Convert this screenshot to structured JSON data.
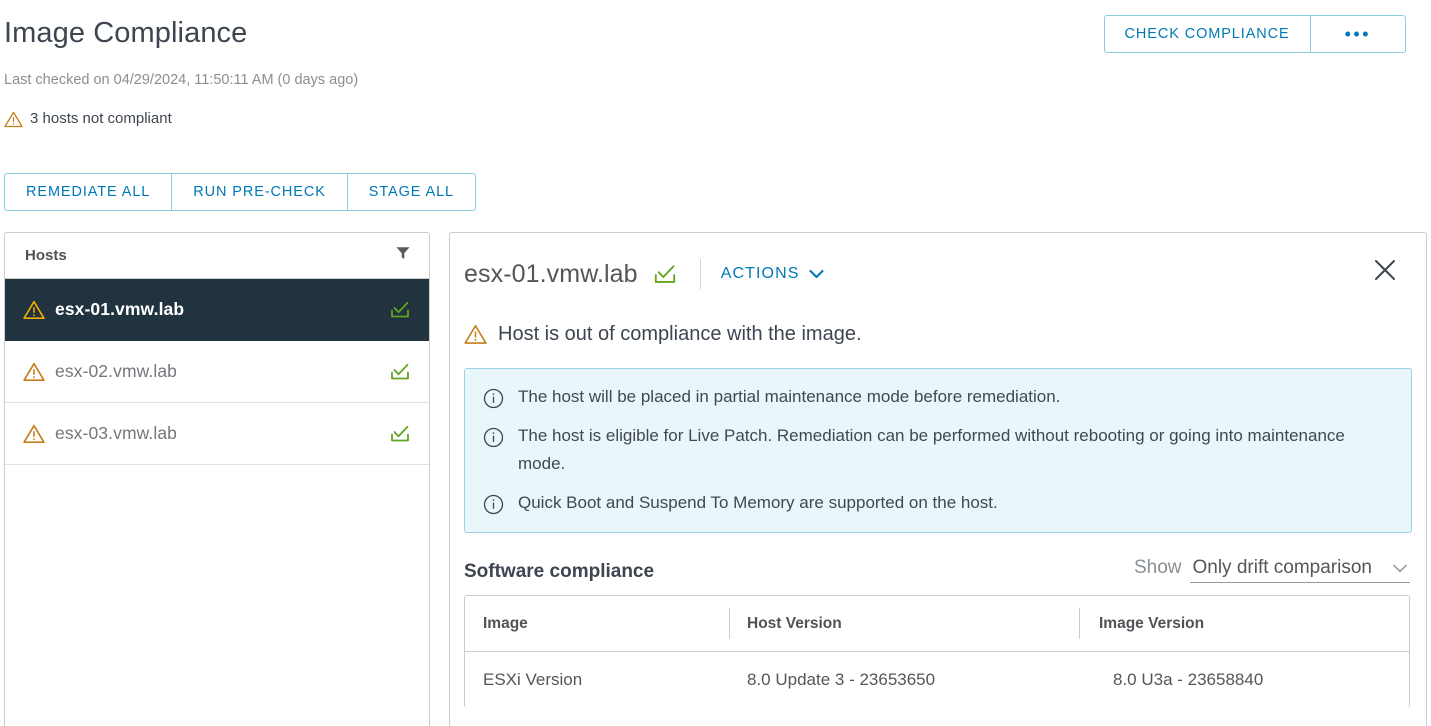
{
  "header": {
    "title": "Image Compliance",
    "last_checked": "Last checked on 04/29/2024, 11:50:11 AM (0 days ago)",
    "status_text": "3 hosts not compliant",
    "check_compliance_label": "CHECK COMPLIANCE",
    "overflow_label": "•••"
  },
  "toolbar": {
    "buttons": [
      {
        "label": "REMEDIATE ALL"
      },
      {
        "label": "RUN PRE-CHECK"
      },
      {
        "label": "STAGE ALL"
      }
    ]
  },
  "hosts_panel": {
    "header_label": "Hosts",
    "filter_icon": "filter-funnel-icon",
    "rows": [
      {
        "name": "esx-01.vmw.lab",
        "selected": true,
        "status_icon": "warning-triangle-icon",
        "action_icon": "stage-tray-check-icon"
      },
      {
        "name": "esx-02.vmw.lab",
        "selected": false,
        "status_icon": "warning-triangle-icon",
        "action_icon": "stage-tray-check-icon"
      },
      {
        "name": "esx-03.vmw.lab",
        "selected": false,
        "status_icon": "warning-triangle-icon",
        "action_icon": "stage-tray-check-icon"
      }
    ]
  },
  "detail": {
    "host_name": "esx-01.vmw.lab",
    "host_icon": "stage-tray-check-icon",
    "actions_label": "ACTIONS",
    "actions_chevron": "chevron-down-icon",
    "close_icon": "close-icon",
    "compliance_warning": "Host is out of compliance with the image.",
    "compliance_warning_icon": "warning-triangle-icon",
    "info_messages": [
      "The host will be placed in partial maintenance mode before remediation.",
      "The host is eligible for Live Patch. Remediation can be performed without rebooting or going into maintenance mode.",
      "Quick Boot and Suspend To Memory are supported on the host."
    ],
    "software_compliance": {
      "title": "Software compliance",
      "show_label": "Show",
      "show_value": "Only drift comparison",
      "show_chevron": "chevron-down-icon",
      "table": {
        "columns": [
          "Image",
          "Host Version",
          "Image Version"
        ],
        "rows": [
          {
            "image": "ESXi Version",
            "host_version": "8.0 Update 3 - 23653650",
            "image_version": "8.0 U3a - 23658840"
          }
        ]
      }
    }
  },
  "colors": {
    "accent_link": "#0079b8",
    "warning_amber": "#c47d17",
    "warning_amber_selected": "#f0ab00",
    "success_green": "#62a420",
    "selected_row_bg": "#20333f",
    "info_bg": "#e9f7fb",
    "info_border": "#9cd2e6"
  }
}
